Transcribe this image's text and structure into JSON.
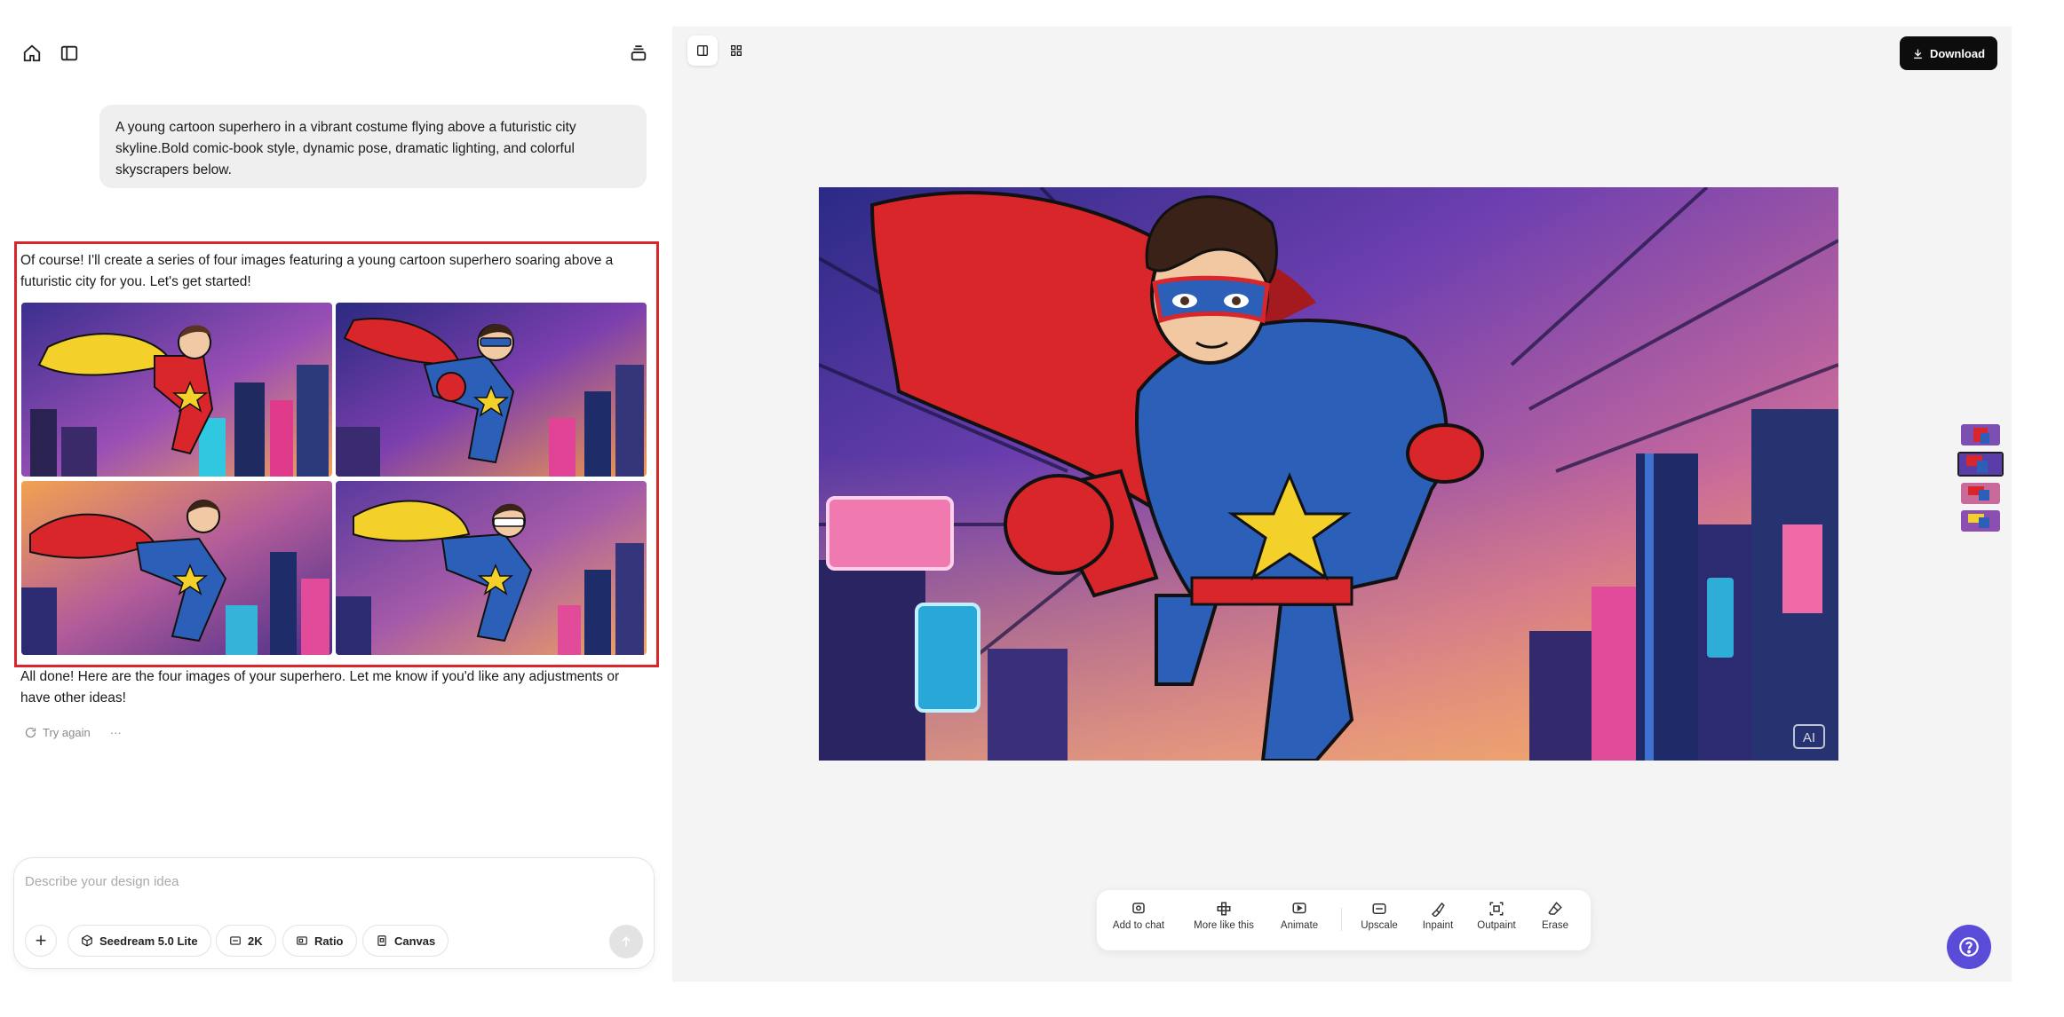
{
  "sidebar": {
    "home_icon": "home-icon",
    "panel_icon": "sidebar-toggle-icon",
    "history_icon": "history-stack-icon"
  },
  "chat": {
    "user_message": "A young cartoon superhero in a vibrant costume flying above a futuristic city skyline.Bold comic-book style, dynamic pose, dramatic lighting, and colorful skyscrapers below.",
    "assistant_intro": "Of course! I'll create a series of four images featuring a young cartoon superhero soaring above a futuristic city for you. Let's get started!",
    "assistant_outro": "All done! Here are the four images of your superhero. Let me know if you'd like any adjustments or have other ideas!",
    "try_again_label": "Try again",
    "more_label": "···",
    "images": [
      {
        "name": "yellow-cape-red-suit"
      },
      {
        "name": "red-cape-blue-suit-masked"
      },
      {
        "name": "red-cape-blue-suit-sunset"
      },
      {
        "name": "yellow-cape-blue-suit-visor"
      }
    ]
  },
  "composer": {
    "placeholder": "Describe your design idea",
    "plus_label": "+",
    "chips": [
      {
        "label": "Seedream 5.0 Lite",
        "icon": "cube-icon"
      },
      {
        "label": "2K",
        "icon": "resolution-icon"
      },
      {
        "label": "Ratio",
        "icon": "ratio-icon"
      },
      {
        "label": "Canvas",
        "icon": "canvas-icon"
      }
    ]
  },
  "canvas": {
    "download_label": "Download",
    "watermark": "AI",
    "tools": [
      {
        "label": "Add to chat",
        "icon": "add-to-chat-icon"
      },
      {
        "label": "More like this",
        "icon": "more-like-this-icon"
      },
      {
        "label": "Animate",
        "icon": "animate-icon"
      },
      {
        "label": "Upscale",
        "icon": "upscale-icon"
      },
      {
        "label": "Inpaint",
        "icon": "inpaint-icon"
      },
      {
        "label": "Outpaint",
        "icon": "outpaint-icon"
      },
      {
        "label": "Erase",
        "icon": "erase-icon"
      }
    ]
  },
  "colors": {
    "highlight_border": "#d9262b",
    "help_button": "#5b4bd9",
    "download_bg": "#0d0d0d"
  }
}
